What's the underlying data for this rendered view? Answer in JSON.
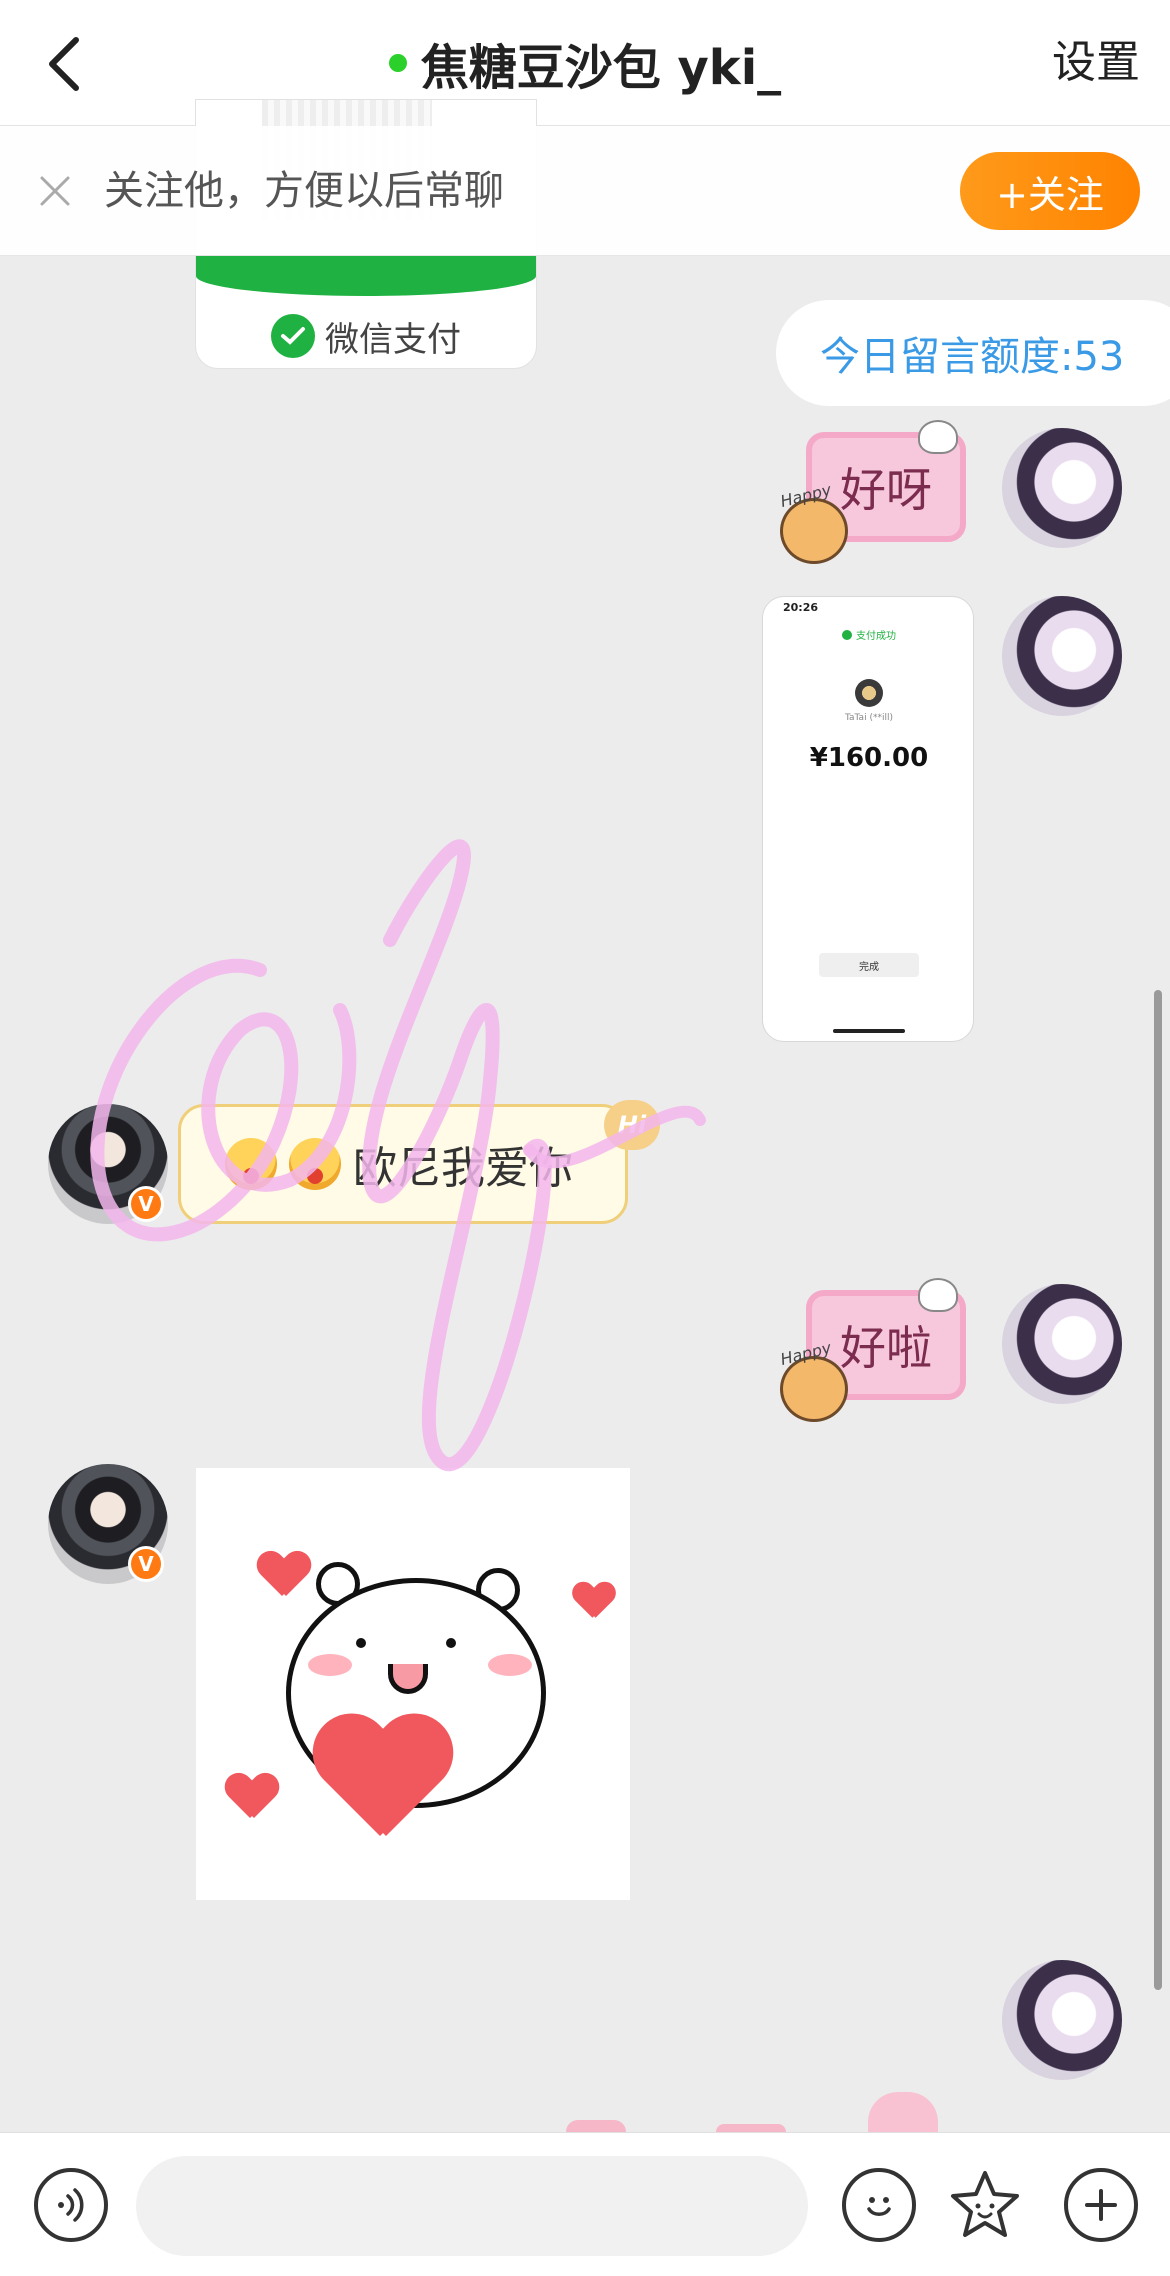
{
  "header": {
    "title": "焦糖豆沙包 yki_",
    "settings_label": "设置",
    "online_color": "#2bd02b"
  },
  "banner": {
    "text": "关注他，方便以后常聊",
    "follow_button": "+关注"
  },
  "wechat_card": {
    "label": "微信支付"
  },
  "quota": {
    "text": "今日留言额度:53"
  },
  "messages": {
    "sticker_1": "好呀",
    "sticker_2": "好啦",
    "sticker_tag": "Happy",
    "payment": {
      "time": "20:26",
      "status": "支付成功",
      "name": "TaTai (**ill)",
      "amount": "¥160.00",
      "done_label": "完成"
    },
    "text_bubble": "欧尼我爱你",
    "hi_badge": "Hi"
  },
  "badges": {
    "verified": "V"
  },
  "input": {
    "placeholder": ""
  },
  "colors": {
    "accent": "#ff8a00",
    "quota_text": "#3a9ae6",
    "wechat_green": "#1fb141"
  }
}
